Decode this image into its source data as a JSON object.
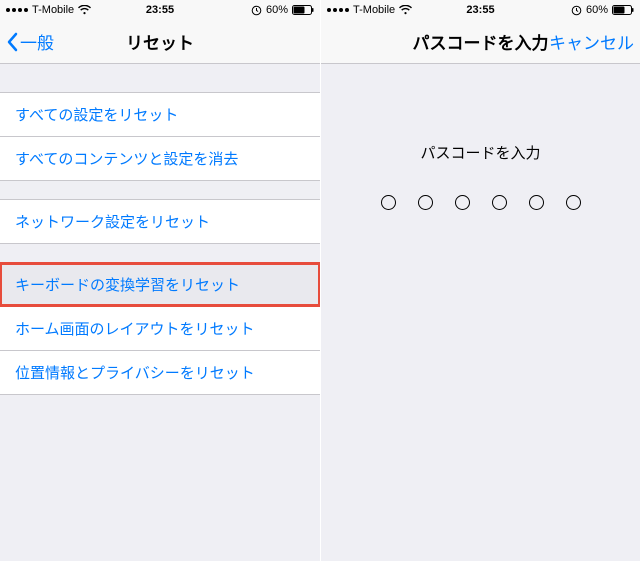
{
  "status": {
    "carrier": "T-Mobile",
    "time": "23:55",
    "battery_pct": "60%"
  },
  "left": {
    "back_label": "一般",
    "title": "リセット",
    "groups": [
      {
        "cells": [
          {
            "label": "すべての設定をリセット",
            "name": "reset-all-settings"
          },
          {
            "label": "すべてのコンテンツと設定を消去",
            "name": "erase-all-content"
          }
        ]
      },
      {
        "cells": [
          {
            "label": "ネットワーク設定をリセット",
            "name": "reset-network-settings"
          }
        ]
      },
      {
        "cells": [
          {
            "label": "キーボードの変換学習をリセット",
            "name": "reset-keyboard-dictionary",
            "highlight": true
          },
          {
            "label": "ホーム画面のレイアウトをリセット",
            "name": "reset-home-layout"
          },
          {
            "label": "位置情報とプライバシーをリセット",
            "name": "reset-location-privacy"
          }
        ]
      }
    ]
  },
  "right": {
    "title": "パスコードを入力",
    "cancel": "キャンセル",
    "prompt": "パスコードを入力",
    "digits": 6
  }
}
